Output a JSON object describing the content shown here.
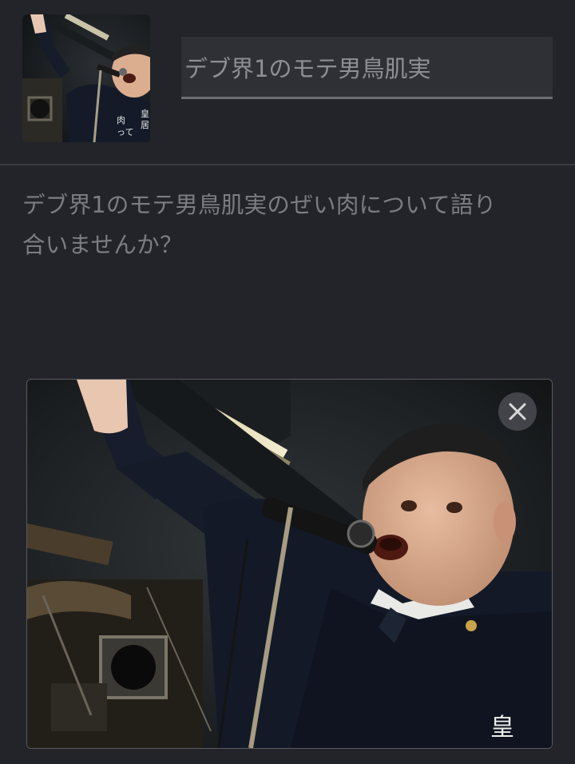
{
  "post": {
    "title_value": "デブ界1のモテ男鳥肌実",
    "body": "デブ界1のモテ男鳥肌実のぜい肉について語り\n合いませんか？"
  },
  "thumbnail": {
    "icon": "photo-thumbnail",
    "uniform_text": "皇 居 肉 って"
  },
  "attachment": {
    "icon": "attached-photo",
    "remove_icon": "close-icon",
    "uniform_text": "皇"
  },
  "colors": {
    "background": "#232429",
    "input_background": "#2f3036",
    "text_muted": "#8e8f95",
    "body_text": "#7c7d83",
    "divider": "#3c3d43"
  }
}
